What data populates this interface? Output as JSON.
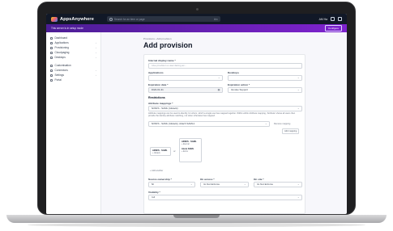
{
  "app": {
    "logo_text": "AppsAnywhere",
    "search_placeholder": "Search for an item or page",
    "search_shortcut": "⌘K",
    "user_name": "AM Ha"
  },
  "banner": {
    "text": "This server is in setup mode",
    "button": "Configure"
  },
  "sidebar": {
    "items": [
      {
        "label": "Dashboard",
        "icon": "home-icon",
        "chevron": ""
      },
      {
        "label": "Applications",
        "icon": "grid-icon",
        "chevron": "›"
      },
      {
        "label": "Provisioning",
        "icon": "box-icon",
        "chevron": "›"
      },
      {
        "label": "Cloudpaging",
        "icon": "cloud-icon",
        "chevron": "›"
      },
      {
        "label": "Desktops",
        "icon": "monitor-icon",
        "chevron": "›"
      },
      {
        "label": "Customisation",
        "icon": "brush-icon",
        "chevron": ""
      },
      {
        "label": "Connectors",
        "icon": "plug-icon",
        "chevron": "›"
      },
      {
        "label": "Settings",
        "icon": "gear-icon",
        "chevron": "›"
      },
      {
        "label": "Portal",
        "icon": "external-icon",
        "chevron": ""
      }
    ]
  },
  "page": {
    "breadcrumb": "Provisions  ›  Add provision",
    "title": "Add provision"
  },
  "form": {
    "internal_name_label": "Internal display name *",
    "internal_name_placeholder": "Give provision a user-facing ac...",
    "applications_label": "Applications",
    "desktops_label": "Desktops",
    "expiration_date_label": "Expiration date *",
    "expiration_date_value": "2022-01-31",
    "expiration_action_label": "Expiration action *",
    "expiration_action_value": "Revoke Support",
    "restrictions_heading": "Restrictions",
    "attribute_mappings_label": "Attribute mappings *",
    "mapping_1": "ADSFS - SAML (Idstack)",
    "mapping_help": "Attribute mappings can be used to identify, for whom, which a single use has mapped together. Within within Attribute mapping, 'Attribute' shows all users then provide the identity attribute matching, not when otherwise has mapped.",
    "mapping_2": "ADSFS - SAML (Idstack), Attach SAML2",
    "remove_mapping": "Remove mapping",
    "add_mapping": "Add mapping",
    "diagram": {
      "box1_title": "ADSFS - SAML",
      "box1_sub": "+ Idstack",
      "or": "or",
      "box2_title": "ADSFS - SAML",
      "box2_sub": "+ Eternal",
      "box3_title": "Azure SAML",
      "box3_sub": "+ Entra"
    },
    "add_another": "+ Add another",
    "source_ownership_label": "Source ownership *",
    "source_ownership_value": "All",
    "on_access_label": "On access *",
    "on_access_value": "Do Not Enforce",
    "on_site_label": "On site *",
    "on_site_value": "Do Not Enforce",
    "visibility_label": "Visibility *",
    "visibility_value": "Full"
  }
}
